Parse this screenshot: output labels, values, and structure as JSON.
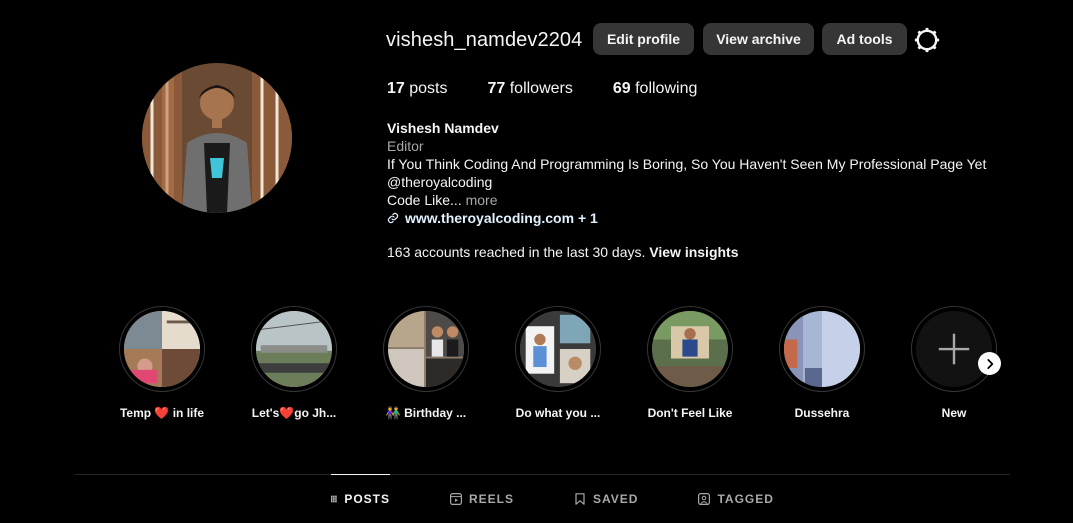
{
  "profile": {
    "username": "vishesh_namdev2204",
    "edit_profile_label": "Edit profile",
    "view_archive_label": "View archive",
    "ad_tools_label": "Ad tools",
    "settings_icon": "gear-icon"
  },
  "stats": {
    "posts_count": "17",
    "posts_label": " posts",
    "followers_count": "77",
    "followers_label": " followers",
    "following_count": "69",
    "following_label": " following"
  },
  "bio": {
    "full_name": "Vishesh Namdev",
    "category": "Editor",
    "line1": "If You Think Coding And Programming Is Boring, So You Haven't Seen My Professional Page Yet",
    "line2": "@theroyalcoding",
    "line3": "Code Like...",
    "more_label": " more",
    "link_text": "www.theroyalcoding.com + 1",
    "link_icon": "link-icon"
  },
  "insights": {
    "text": "163 accounts reached in the last 30 days. ",
    "action": "View insights"
  },
  "highlights": [
    {
      "label_pre": "Temp ",
      "heart": "❤️",
      "label_post": " in life"
    },
    {
      "label_pre": "Let's",
      "heart": "❤️",
      "label_post": "go Jh..."
    },
    {
      "label_pre": "👫 Birthday ...",
      "heart": "",
      "label_post": ""
    },
    {
      "label_pre": "Do what you ...",
      "heart": "",
      "label_post": ""
    },
    {
      "label_pre": "Don't Feel Like",
      "heart": "",
      "label_post": ""
    },
    {
      "label_pre": "Dussehra",
      "heart": "",
      "label_post": ""
    },
    {
      "label_pre": "New",
      "heart": "",
      "label_post": ""
    }
  ],
  "tabs": {
    "posts": "POSTS",
    "reels": "REELS",
    "saved": "SAVED",
    "tagged": "TAGGED"
  },
  "colors": {
    "background": "#000000",
    "button": "#363636",
    "muted": "#a8a8a8",
    "heart": "#ed2a3b"
  }
}
